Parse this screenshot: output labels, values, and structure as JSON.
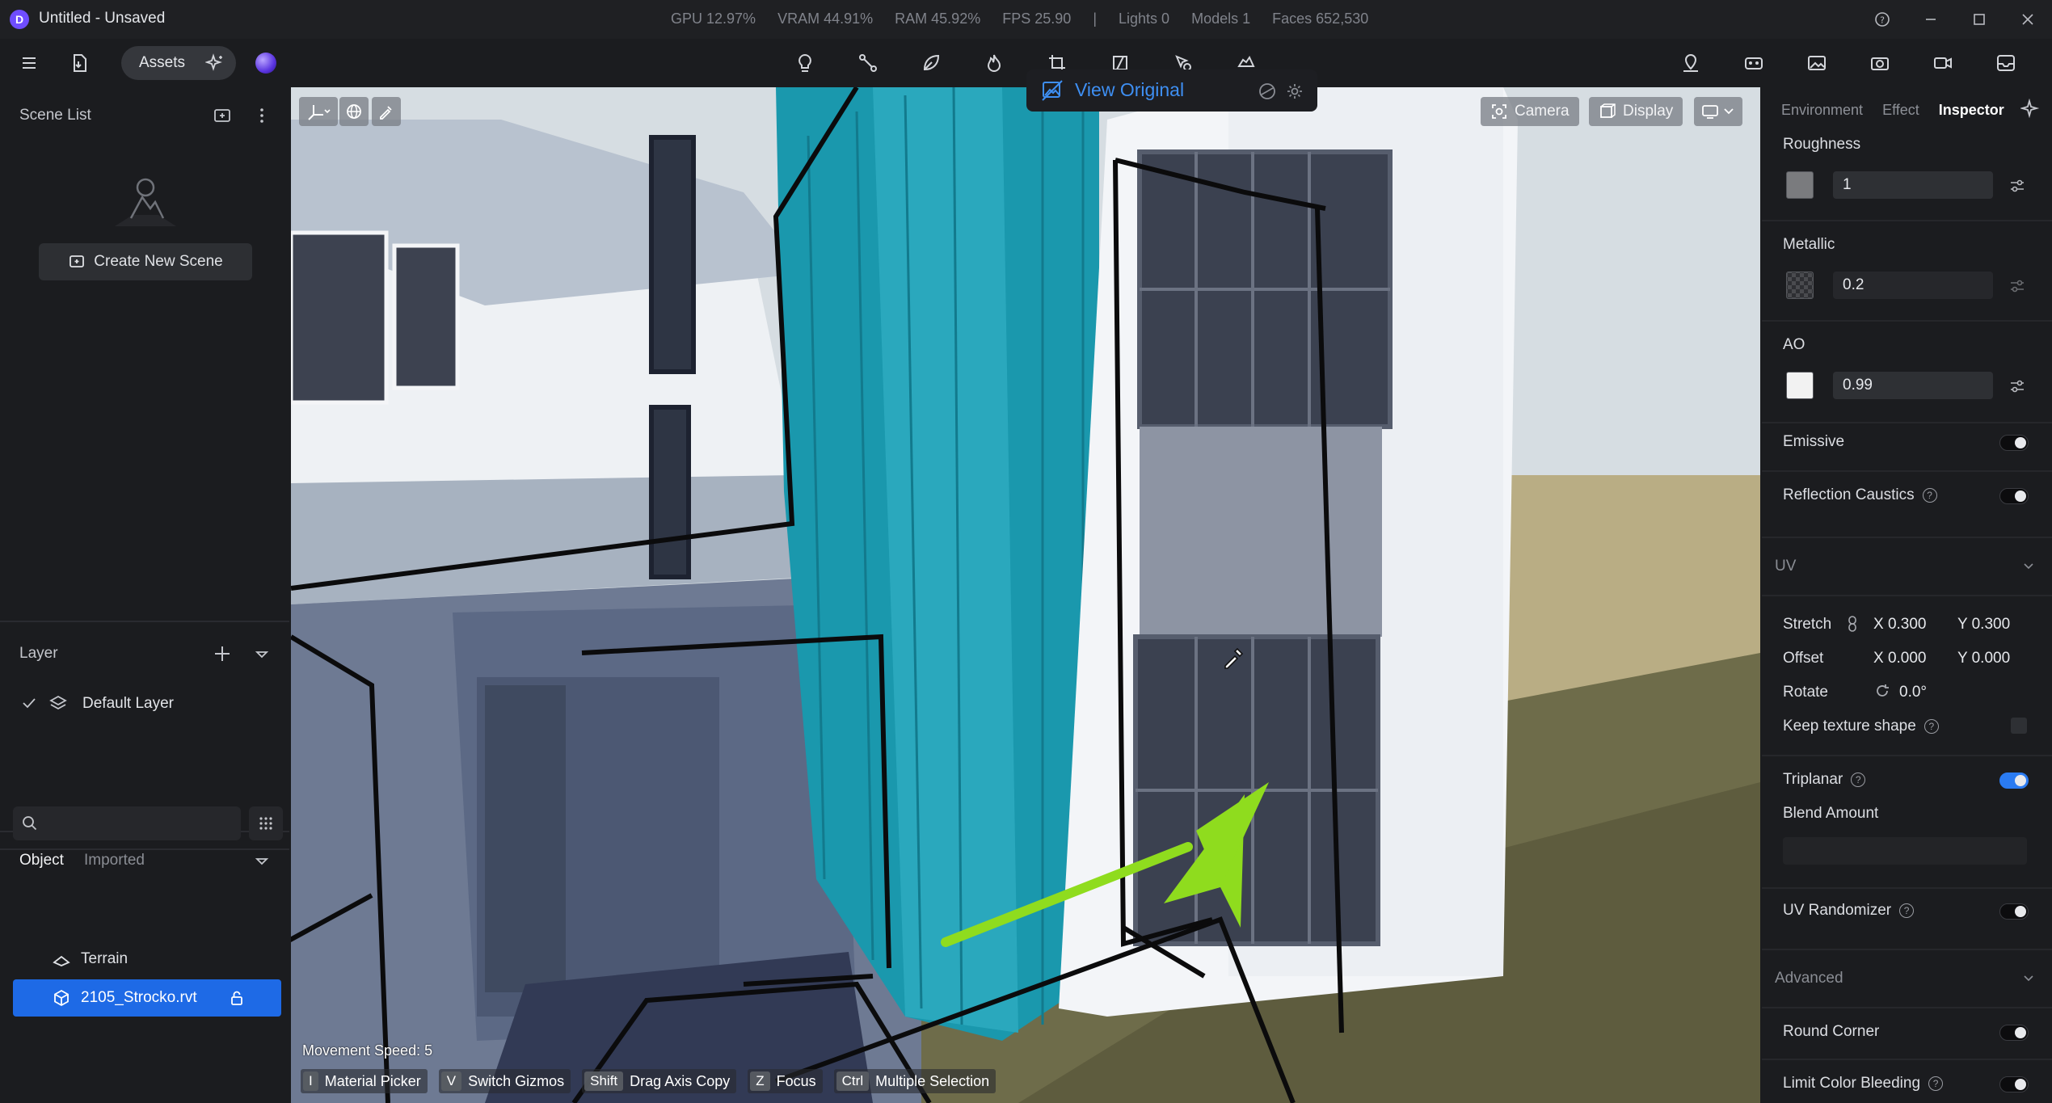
{
  "window": {
    "title": "Untitled - Unsaved",
    "logo_letter": "D",
    "stats": [
      "GPU 12.97%",
      "VRAM 44.91%",
      "RAM 45.92%",
      "FPS 25.90",
      "|",
      "Lights 0",
      "Models 1",
      "Faces 652,530"
    ]
  },
  "toolbar": {
    "assets_label": "Assets"
  },
  "left_panel": {
    "scene_list_title": "Scene List",
    "create_scene_label": "Create New Scene",
    "layer_title": "Layer",
    "default_layer_label": "Default Layer",
    "object_tab": "Object",
    "imported_tab": "Imported",
    "search_placeholder": "",
    "tree": [
      {
        "label": "Terrain",
        "icon": "terrain-icon"
      },
      {
        "label": "2105_Strocko.rvt",
        "icon": "model-cube-icon",
        "selected": true
      }
    ]
  },
  "viewport": {
    "camera_label": "Camera",
    "display_label": "Display",
    "view_original_label": "View Original",
    "movement_speed": "Movement Speed: 5",
    "shortcuts": [
      {
        "key": "I",
        "label": "Material Picker"
      },
      {
        "key": "V",
        "label": "Switch Gizmos"
      },
      {
        "key": "Shift",
        "label": "Drag Axis Copy"
      },
      {
        "key": "Z",
        "label": "Focus"
      },
      {
        "key": "Ctrl",
        "label": "Multiple Selection"
      }
    ],
    "annotation_arrow_color": "#8fdc1e",
    "wall_color": "#1a98ad",
    "sky_color": "#d6dde2"
  },
  "inspector": {
    "tabs": [
      "Environment",
      "Effect",
      "Inspector"
    ],
    "active_tab": "Inspector",
    "roughness": {
      "label": "Roughness",
      "value": "1"
    },
    "metallic": {
      "label": "Metallic",
      "value": "0.2"
    },
    "ao": {
      "label": "AO",
      "value": "0.99"
    },
    "emissive": {
      "label": "Emissive",
      "on": false
    },
    "reflection_caustics": {
      "label": "Reflection Caustics",
      "on": false
    },
    "uv": {
      "title": "UV",
      "stretch_label": "Stretch",
      "stretch_x": "X 0.300",
      "stretch_y": "Y 0.300",
      "offset_label": "Offset",
      "offset_x": "X 0.000",
      "offset_y": "Y 0.000",
      "rotate_label": "Rotate",
      "rotate_value": "0.0°",
      "keep_texture_label": "Keep texture shape",
      "triplanar_label": "Triplanar",
      "triplanar_on": true,
      "blend_label": "Blend Amount",
      "uv_randomizer_label": "UV Randomizer"
    },
    "advanced": {
      "title": "Advanced",
      "round_corner_label": "Round Corner",
      "limit_color_label": "Limit Color Bleeding"
    },
    "accent_color": "#2a7bf2"
  }
}
